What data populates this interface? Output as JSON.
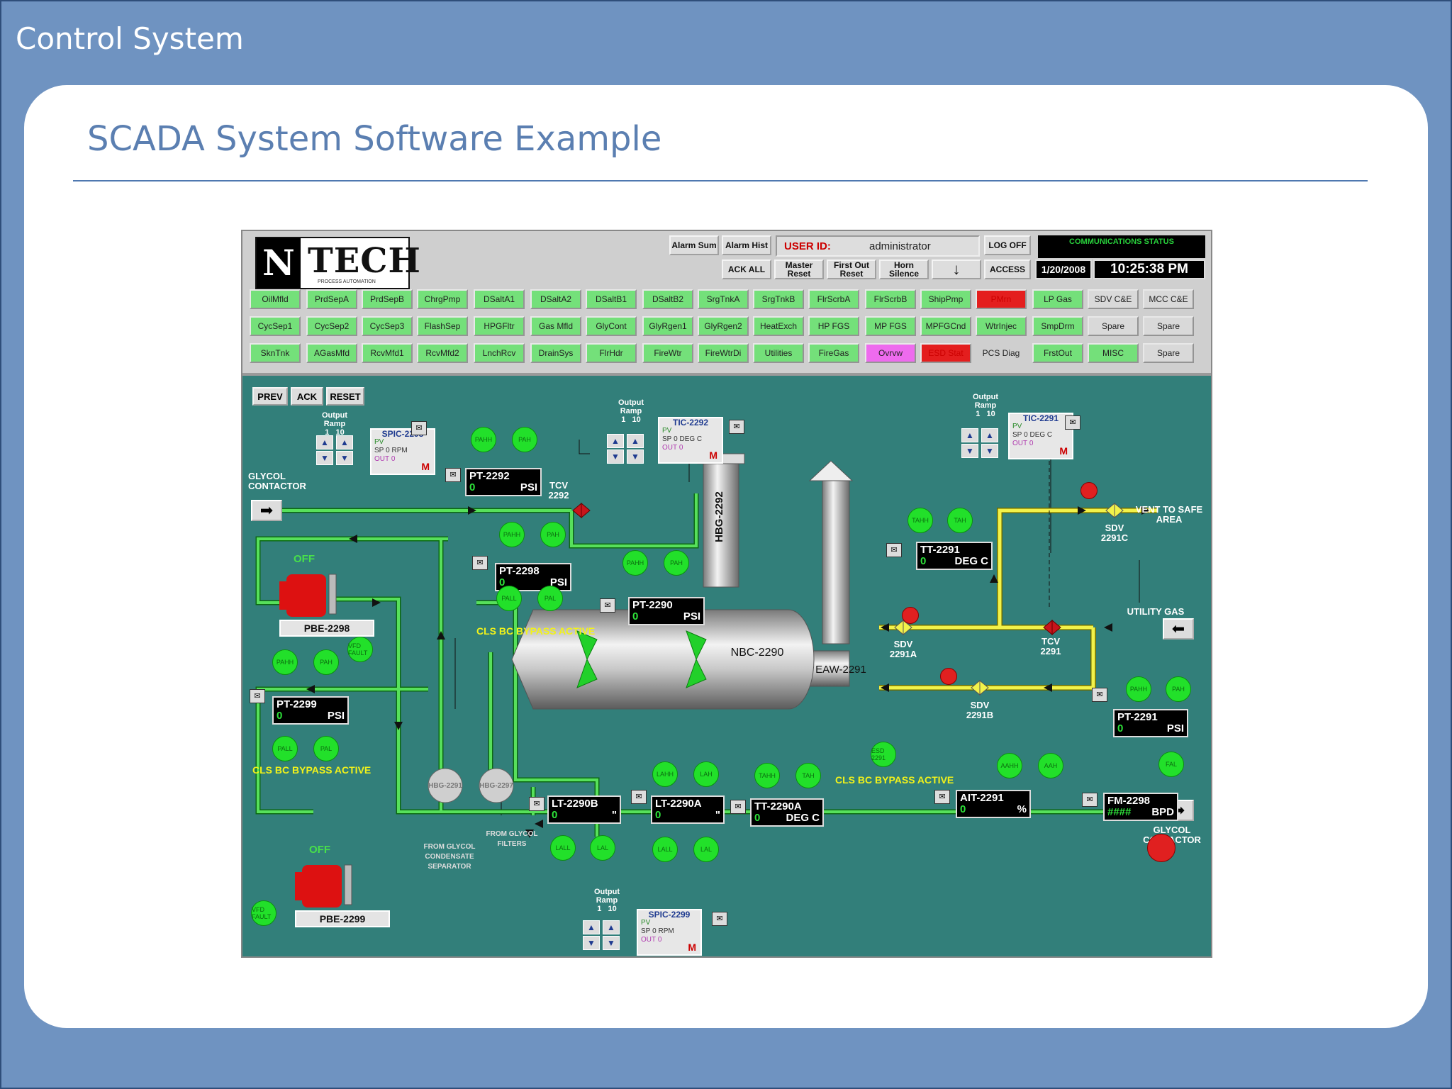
{
  "slide": {
    "deck_title": "Control System",
    "title": "SCADA System Software Example"
  },
  "scada": {
    "logo": {
      "letter": "N",
      "text": "TECH",
      "subtext": "PROCESS AUTOMATION"
    },
    "header_buttons": {
      "alarm_sum": "Alarm Sum",
      "alarm_hist": "Alarm Hist",
      "ack_all": "ACK ALL",
      "master_reset": "Master Reset",
      "first_out_reset": "First Out Reset",
      "horn_silence": "Horn Silence",
      "down_arrow": "↓",
      "log_off": "LOG OFF",
      "access": "ACCESS"
    },
    "user": {
      "label": "USER ID:",
      "value": "administrator"
    },
    "comm_status": "COMMUNICATIONS STATUS",
    "date": "1/20/2008",
    "time": "10:25:38 PM",
    "nav_rows": [
      [
        [
          "OilMfld",
          "g"
        ],
        [
          "PrdSepA",
          "g"
        ],
        [
          "PrdSepB",
          "g"
        ],
        [
          "ChrgPmp",
          "g"
        ],
        [
          "DSaltA1",
          "g"
        ],
        [
          "DSaltA2",
          "g"
        ],
        [
          "DSaltB1",
          "g"
        ],
        [
          "DSaltB2",
          "g"
        ],
        [
          "SrgTnkA",
          "g"
        ],
        [
          "SrgTnkB",
          "g"
        ],
        [
          "FlrScrbA",
          "g"
        ],
        [
          "FlrScrbB",
          "g"
        ],
        [
          "ShipPmp",
          "g"
        ],
        [
          "PMrn",
          "r"
        ],
        [
          "LP Gas",
          "g"
        ],
        [
          "SDV C&E",
          "n"
        ],
        [
          "MCC C&E",
          "n"
        ]
      ],
      [
        [
          "CycSep1",
          "g"
        ],
        [
          "CycSep2",
          "g"
        ],
        [
          "CycSep3",
          "g"
        ],
        [
          "FlashSep",
          "g"
        ],
        [
          "HPGFltr",
          "g"
        ],
        [
          "Gas Mfld",
          "g"
        ],
        [
          "GlyCont",
          "g"
        ],
        [
          "GlyRgen1",
          "g"
        ],
        [
          "GlyRgen2",
          "g"
        ],
        [
          "HeatExch",
          "g"
        ],
        [
          "HP FGS",
          "g"
        ],
        [
          "MP FGS",
          "g"
        ],
        [
          "MPFGCnd",
          "g"
        ],
        [
          "WtrInjec",
          "g"
        ],
        [
          "SmpDrm",
          "g"
        ],
        [
          "Spare",
          "n"
        ],
        [
          "Spare",
          "n"
        ]
      ],
      [
        [
          "SknTnk",
          "g"
        ],
        [
          "AGasMfd",
          "g"
        ],
        [
          "RcvMfd1",
          "g"
        ],
        [
          "RcvMfd2",
          "g"
        ],
        [
          "LnchRcv",
          "g"
        ],
        [
          "DrainSys",
          "g"
        ],
        [
          "FlrHdr",
          "g"
        ],
        [
          "FireWtr",
          "g"
        ],
        [
          "FireWtrDi",
          "g"
        ],
        [
          "Utilities",
          "g"
        ],
        [
          "FireGas",
          "g"
        ],
        [
          "Ovrvw",
          "m"
        ],
        [
          "ESD Stat",
          "r"
        ],
        [
          "PCS Diag",
          "x"
        ],
        [
          "FrstOut",
          "g"
        ],
        [
          "MISC",
          "g"
        ],
        [
          "Spare",
          "n"
        ]
      ]
    ],
    "process": {
      "buttons": {
        "prev": "PREV",
        "ack": "ACK",
        "reset": "RESET"
      },
      "labels": {
        "glycol_contactor_in": "GLYCOL CONTACTOR",
        "glycol_contactor_out": "GLYCOL CONTACTOR",
        "vent": "VENT TO SAFE AREA",
        "utility_gas": "UTILITY GAS",
        "from_glycol_condensate": "FROM GLYCOL CONDENSATE SEPARATOR",
        "from_glycol_filters": "FROM GLYCOL FILTERS",
        "tcv_2292": "TCV 2292",
        "tcv_2291": "TCV 2291",
        "sdv_2291a": "SDV 2291A",
        "sdv_2291b": "SDV 2291B",
        "sdv_2291c": "SDV 2291C",
        "hbg_2292": "HBG-2292",
        "nbc_2290": "NBC-2290",
        "eaw_2291": "EAW-2291",
        "hbg_2291": "HBG-2291",
        "hbg_2297": "HBG-2297",
        "pump1": "PBE-2298",
        "pump2": "PBE-2299",
        "off": "OFF",
        "bypass": "CLS BC BYPASS ACTIVE",
        "output_ramp": "Output Ramp",
        "ramp_1": "1",
        "ramp_10": "10"
      },
      "tags": [
        {
          "name": "PT-2292",
          "value": "0",
          "unit": "PSI"
        },
        {
          "name": "PT-2298",
          "value": "0",
          "unit": "PSI"
        },
        {
          "name": "PT-2290",
          "value": "0",
          "unit": "PSI"
        },
        {
          "name": "PT-2299",
          "value": "0",
          "unit": "PSI"
        },
        {
          "name": "TT-2291",
          "value": "0",
          "unit": "DEG C"
        },
        {
          "name": "PT-2291",
          "value": "0",
          "unit": "PSI"
        },
        {
          "name": "LT-2290B",
          "value": "0",
          "unit": "\""
        },
        {
          "name": "LT-2290A",
          "value": "0",
          "unit": "\""
        },
        {
          "name": "TT-2290A",
          "value": "0",
          "unit": "DEG C"
        },
        {
          "name": "AIT-2291",
          "value": "0",
          "unit": "%"
        },
        {
          "name": "FM-2298",
          "value": "####",
          "unit": "BPD"
        }
      ],
      "controllers": [
        {
          "name": "SPIC-2298",
          "pv": "PV",
          "sp": "SP",
          "sp_val": "0",
          "sp_unit": "RPM",
          "out": "OUT",
          "out_val": "0",
          "mode": "M"
        },
        {
          "name": "TIC-2292",
          "pv": "PV",
          "sp": "SP",
          "sp_val": "0",
          "sp_unit": "DEG C",
          "out": "OUT",
          "out_val": "0",
          "mode": "M"
        },
        {
          "name": "TIC-2291",
          "pv": "PV",
          "sp": "SP",
          "sp_val": "0",
          "sp_unit": "DEG C",
          "out": "OUT",
          "out_val": "0",
          "mode": "M"
        },
        {
          "name": "SPIC-2299",
          "pv": "PV",
          "sp": "SP",
          "sp_val": "0",
          "sp_unit": "RPM",
          "out": "OUT",
          "out_val": "0",
          "mode": "M"
        }
      ],
      "indicators": {
        "pahh": "PAHH",
        "pah": "PAH",
        "pal": "PAL",
        "pall": "PALL",
        "vfd_fault": "VFD FAULT",
        "tahh": "TAHH",
        "tah": "TAH",
        "lahh": "LAHH",
        "lah": "LAH",
        "lal": "LAL",
        "lall": "LALL",
        "aahh": "AAHH",
        "aah": "AAH",
        "fal": "FAL",
        "esd": "ESD 2291"
      }
    },
    "colors": {
      "process_bg": "#327f7a",
      "pipe_green": "#57e05b",
      "pipe_yellow": "#f2f24a",
      "indicator": "#22e02a",
      "alarm": "#e02020",
      "slide_bg": "#6f93c1",
      "title_blue": "#5b7fb1"
    }
  }
}
